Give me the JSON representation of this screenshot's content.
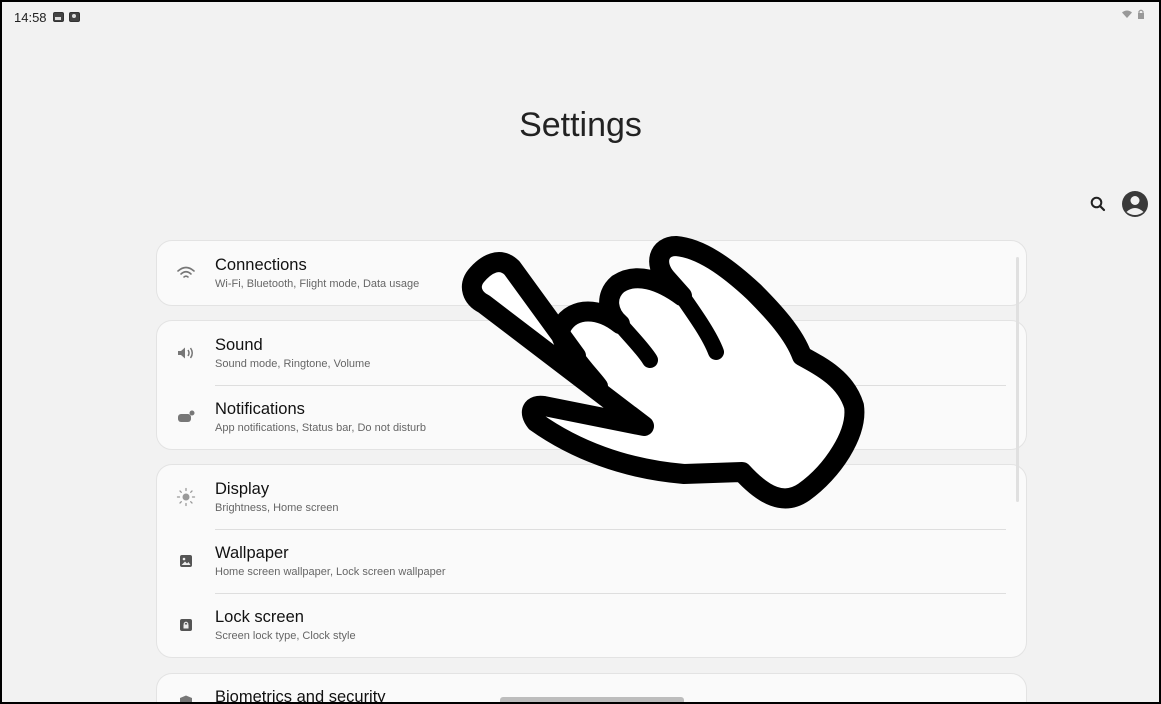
{
  "statusbar": {
    "time": "14:58",
    "notification_icons": [
      "photo-icon",
      "record-icon"
    ],
    "right_icons": [
      "wifi-icon",
      "lock-icon"
    ]
  },
  "header": {
    "title": "Settings",
    "actions": [
      "search-icon",
      "account-icon"
    ]
  },
  "cards": [
    {
      "items": [
        {
          "id": "connections",
          "icon": "wifi-icon",
          "title": "Connections",
          "subtitle": "Wi-Fi, Bluetooth, Flight mode, Data usage"
        }
      ]
    },
    {
      "items": [
        {
          "id": "sound",
          "icon": "speaker-icon",
          "title": "Sound",
          "subtitle": "Sound mode, Ringtone, Volume"
        },
        {
          "id": "notifications",
          "icon": "notification-icon",
          "title": "Notifications",
          "subtitle": "App notifications, Status bar, Do not disturb"
        }
      ]
    },
    {
      "items": [
        {
          "id": "display",
          "icon": "brightness-icon",
          "title": "Display",
          "subtitle": "Brightness, Home screen"
        },
        {
          "id": "wallpaper",
          "icon": "wallpaper-icon",
          "title": "Wallpaper",
          "subtitle": "Home screen wallpaper, Lock screen wallpaper"
        },
        {
          "id": "lock-screen",
          "icon": "lock-icon",
          "title": "Lock screen",
          "subtitle": "Screen lock type, Clock style"
        }
      ]
    },
    {
      "items": [
        {
          "id": "biometrics",
          "icon": "shield-icon",
          "title": "Biometrics and security",
          "subtitle": ""
        }
      ]
    }
  ],
  "overlay": {
    "icon": "pointing-hand-icon"
  },
  "colors": {
    "background": "#f2f2f2",
    "card": "#fafafa",
    "text": "#111111",
    "subtext": "#666666"
  }
}
